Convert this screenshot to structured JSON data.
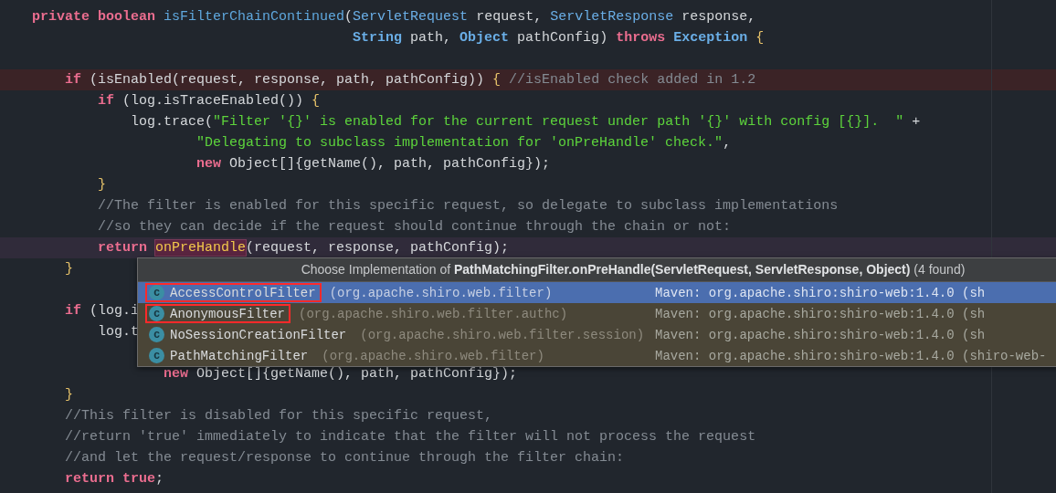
{
  "editor": {
    "lines": [
      {
        "error": false,
        "current": false,
        "tokens": [
          {
            "kind": "kw",
            "text": "private boolean"
          },
          {
            "kind": "fn",
            "text": " isFilterChainContinued"
          },
          {
            "kind": "plain",
            "text": "("
          },
          {
            "kind": "type",
            "text": "ServletRequest"
          },
          {
            "kind": "plain",
            "text": " request, "
          },
          {
            "kind": "type",
            "text": "ServletResponse"
          },
          {
            "kind": "plain",
            "text": " response,"
          }
        ]
      },
      {
        "error": false,
        "current": false,
        "tokens": [
          {
            "kind": "typeb",
            "text": "                                       String"
          },
          {
            "kind": "plain",
            "text": " path, "
          },
          {
            "kind": "typeb",
            "text": "Object"
          },
          {
            "kind": "plain",
            "text": " pathConfig) "
          },
          {
            "kind": "kw",
            "text": "throws"
          },
          {
            "kind": "typeb",
            "text": " Exception"
          },
          {
            "kind": "brace",
            "text": " {"
          }
        ]
      },
      {
        "error": false,
        "current": false
      },
      {
        "error": true,
        "current": false,
        "tokens": [
          {
            "kind": "kw",
            "text": "    if"
          },
          {
            "kind": "plain",
            "text": " (isEnabled(request, response, path, pathConfig)) "
          },
          {
            "kind": "brace",
            "text": "{"
          },
          {
            "kind": "cmt",
            "text": " //isEnabled check added in 1.2"
          }
        ]
      },
      {
        "error": false,
        "current": false,
        "tokens": [
          {
            "kind": "kw",
            "text": "        if"
          },
          {
            "kind": "plain",
            "text": " (log.isTraceEnabled()) "
          },
          {
            "kind": "brace",
            "text": "{"
          }
        ]
      },
      {
        "error": false,
        "current": false,
        "tokens": [
          {
            "kind": "plain",
            "text": "            log.trace("
          },
          {
            "kind": "str",
            "text": "\"Filter '{}' is enabled for the current request under path '{}' with config [{}].  \""
          },
          {
            "kind": "plain",
            "text": " +"
          }
        ]
      },
      {
        "error": false,
        "current": false,
        "tokens": [
          {
            "kind": "str",
            "text": "                    \"Delegating to subclass implementation for 'onPreHandle' check.\""
          },
          {
            "kind": "plain",
            "text": ","
          }
        ]
      },
      {
        "error": false,
        "current": false,
        "tokens": [
          {
            "kind": "kw",
            "text": "                    new"
          },
          {
            "kind": "plain",
            "text": " Object[]{getName(), path, pathConfig});"
          }
        ]
      },
      {
        "error": false,
        "current": false,
        "tokens": [
          {
            "kind": "brace",
            "text": "        }"
          }
        ]
      },
      {
        "error": false,
        "current": false,
        "tokens": [
          {
            "kind": "cmt",
            "text": "        //The filter is enabled for this specific request, so delegate to subclass implementations"
          }
        ]
      },
      {
        "error": false,
        "current": false,
        "tokens": [
          {
            "kind": "cmt",
            "text": "        //so they can decide if the request should continue through the chain or not:"
          }
        ]
      },
      {
        "error": false,
        "current": true,
        "tokens": [
          {
            "kind": "kw",
            "text": "        return "
          },
          {
            "kind": "match",
            "text": "onPreHandle"
          },
          {
            "kind": "plain",
            "text": "(request, response, pathConfig);"
          }
        ]
      },
      {
        "error": false,
        "current": false,
        "tokens": [
          {
            "kind": "brace",
            "text": "    }"
          }
        ]
      },
      {
        "error": false,
        "current": false
      },
      {
        "error": false,
        "current": false,
        "tokens": [
          {
            "kind": "kw",
            "text": "    if"
          },
          {
            "kind": "plain",
            "text": " (log.i"
          }
        ]
      },
      {
        "error": false,
        "current": false,
        "tokens": [
          {
            "kind": "plain",
            "text": "        log.t"
          }
        ]
      },
      {
        "error": false,
        "current": false
      },
      {
        "error": false,
        "current": false,
        "tokens": [
          {
            "kind": "kw",
            "text": "                new"
          },
          {
            "kind": "plain",
            "text": " Object[]{getName(), path, pathConfig});"
          }
        ]
      },
      {
        "error": false,
        "current": false,
        "tokens": [
          {
            "kind": "brace",
            "text": "    }"
          }
        ]
      },
      {
        "error": false,
        "current": false,
        "tokens": [
          {
            "kind": "cmt",
            "text": "    //This filter is disabled for this specific request,"
          }
        ]
      },
      {
        "error": false,
        "current": false,
        "tokens": [
          {
            "kind": "cmt",
            "text": "    //return 'true' immediately to indicate that the filter will not process the request"
          }
        ]
      },
      {
        "error": false,
        "current": false,
        "tokens": [
          {
            "kind": "cmt",
            "text": "    //and let the request/response to continue through the filter chain:"
          }
        ]
      },
      {
        "error": false,
        "current": false,
        "tokens": [
          {
            "kind": "kw",
            "text": "    return true"
          },
          {
            "kind": "plain",
            "text": ";"
          }
        ]
      }
    ]
  },
  "popup": {
    "title": "Choose Implementation of **PathMatchingFilter.onPreHandle(ServletRequest, ServletResponse, Object)** (4 found)",
    "items": [
      {
        "icon_letter": "c",
        "name": "AccessControlFilter",
        "package": "(org.apache.shiro.web.filter)",
        "source": "Maven: org.apache.shiro:shiro-web:1.4.0 (sh",
        "selected": true,
        "annotated": true
      },
      {
        "icon_letter": "c",
        "name": "AnonymousFilter",
        "package": "(org.apache.shiro.web.filter.authc)",
        "source": "Maven: org.apache.shiro:shiro-web:1.4.0 (sh",
        "selected": false,
        "annotated": true
      },
      {
        "icon_letter": "c",
        "name": "NoSessionCreationFilter",
        "package": "(org.apache.shiro.web.filter.session)",
        "source": "Maven: org.apache.shiro:shiro-web:1.4.0 (sh",
        "selected": false,
        "annotated": false
      },
      {
        "icon_letter": "c",
        "name": "PathMatchingFilter",
        "package": "(org.apache.shiro.web.filter)",
        "source": "Maven: org.apache.shiro:shiro-web:1.4.0 (shiro-web-",
        "selected": false,
        "annotated": false
      }
    ]
  }
}
